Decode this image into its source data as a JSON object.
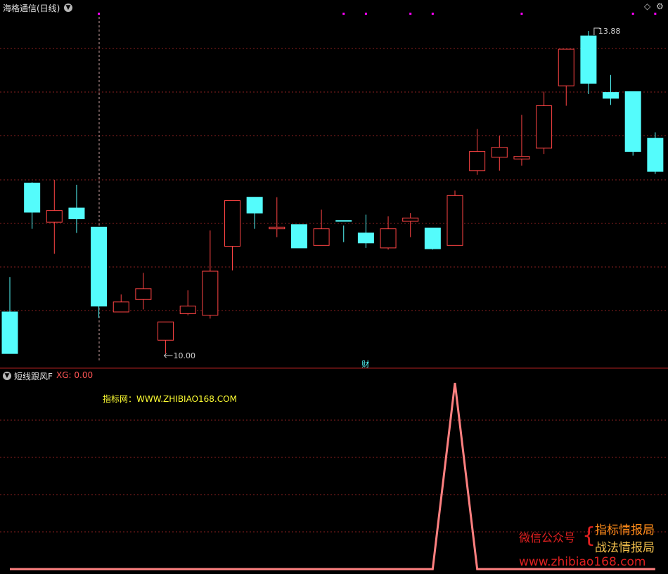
{
  "price_panel": {
    "title": "海格通信(日线)",
    "high_label": "13.88",
    "low_label": "10.00",
    "event_label": "财",
    "colors": {
      "up": "#ff4444",
      "down": "#54fcfc",
      "grid": "#8a2020",
      "marker": "#ff00ff",
      "border": "#b02020"
    }
  },
  "indicator_panel": {
    "name": "短线跟风F",
    "value_text": "XG: 0.00",
    "site_label": "指标网：WWW.ZHIBIAO168.COM",
    "line_color": "#ff8080",
    "line_values": [
      0,
      0,
      0,
      0,
      0,
      0,
      0,
      0,
      0,
      0,
      0,
      0,
      0,
      0,
      0,
      0,
      0,
      0,
      0,
      0,
      1,
      0,
      0,
      0,
      0,
      0,
      0,
      0,
      0,
      0
    ]
  },
  "watermark": {
    "wechat": "微信公众号",
    "brace": "{",
    "line1": "指标情报局",
    "line2": "战法情报局",
    "url": "www.zhibiao168.com"
  },
  "icons": {
    "collapse": "chevron-down-icon",
    "diamond": "diamond-icon",
    "settings": "gear-icon"
  },
  "chart_data": {
    "type": "candlestick",
    "candles": [
      {
        "o": 10.5,
        "h": 10.92,
        "l": 10.05,
        "c": 10.0
      },
      {
        "o": 12.05,
        "h": 12.06,
        "l": 11.5,
        "c": 11.7
      },
      {
        "o": 11.58,
        "h": 12.09,
        "l": 11.2,
        "c": 11.72
      },
      {
        "o": 11.75,
        "h": 12.03,
        "l": 11.45,
        "c": 11.62
      },
      {
        "o": 11.52,
        "h": 11.52,
        "l": 10.43,
        "c": 10.57
      },
      {
        "o": 10.5,
        "h": 10.71,
        "l": 10.6,
        "c": 10.62
      },
      {
        "o": 10.65,
        "h": 10.97,
        "l": 10.53,
        "c": 10.78
      },
      {
        "o": 10.16,
        "h": 10.33,
        "l": 10.0,
        "c": 10.38
      },
      {
        "o": 10.48,
        "h": 10.76,
        "l": 10.46,
        "c": 10.57
      },
      {
        "o": 10.46,
        "h": 11.48,
        "l": 10.42,
        "c": 10.99
      },
      {
        "o": 11.29,
        "h": 11.56,
        "l": 11.0,
        "c": 11.84
      },
      {
        "o": 11.88,
        "h": 11.88,
        "l": 11.5,
        "c": 11.69
      },
      {
        "o": 11.5,
        "h": 11.88,
        "l": 11.4,
        "c": 11.52
      },
      {
        "o": 11.55,
        "h": 11.48,
        "l": 11.29,
        "c": 11.27
      },
      {
        "o": 11.3,
        "h": 11.73,
        "l": 11.3,
        "c": 11.5
      },
      {
        "o": 11.6,
        "h": 11.54,
        "l": 11.34,
        "c": 11.59
      },
      {
        "o": 11.45,
        "h": 11.67,
        "l": 11.27,
        "c": 11.33
      },
      {
        "o": 11.27,
        "h": 11.65,
        "l": 11.25,
        "c": 11.5
      },
      {
        "o": 11.59,
        "h": 11.69,
        "l": 11.4,
        "c": 11.63
      },
      {
        "o": 11.51,
        "h": 11.42,
        "l": 11.25,
        "c": 11.26
      },
      {
        "o": 11.3,
        "h": 11.96,
        "l": 11.31,
        "c": 11.9
      },
      {
        "o": 12.2,
        "h": 12.7,
        "l": 12.15,
        "c": 12.43
      },
      {
        "o": 12.36,
        "h": 12.62,
        "l": 12.2,
        "c": 12.48
      },
      {
        "o": 12.34,
        "h": 12.87,
        "l": 12.26,
        "c": 12.37
      },
      {
        "o": 12.47,
        "h": 13.15,
        "l": 12.4,
        "c": 12.98
      },
      {
        "o": 13.22,
        "h": 13.66,
        "l": 12.98,
        "c": 13.66
      },
      {
        "o": 13.82,
        "h": 13.88,
        "l": 13.12,
        "c": 13.25
      },
      {
        "o": 13.14,
        "h": 13.35,
        "l": 12.99,
        "c": 13.07
      },
      {
        "o": 13.15,
        "h": 13.14,
        "l": 12.38,
        "c": 12.43
      },
      {
        "o": 12.59,
        "h": 12.66,
        "l": 12.16,
        "c": 12.19
      }
    ],
    "ylim": [
      9.9,
      14.1
    ],
    "event_marks": [
      4,
      15,
      16,
      18,
      19,
      23,
      28,
      29
    ]
  }
}
